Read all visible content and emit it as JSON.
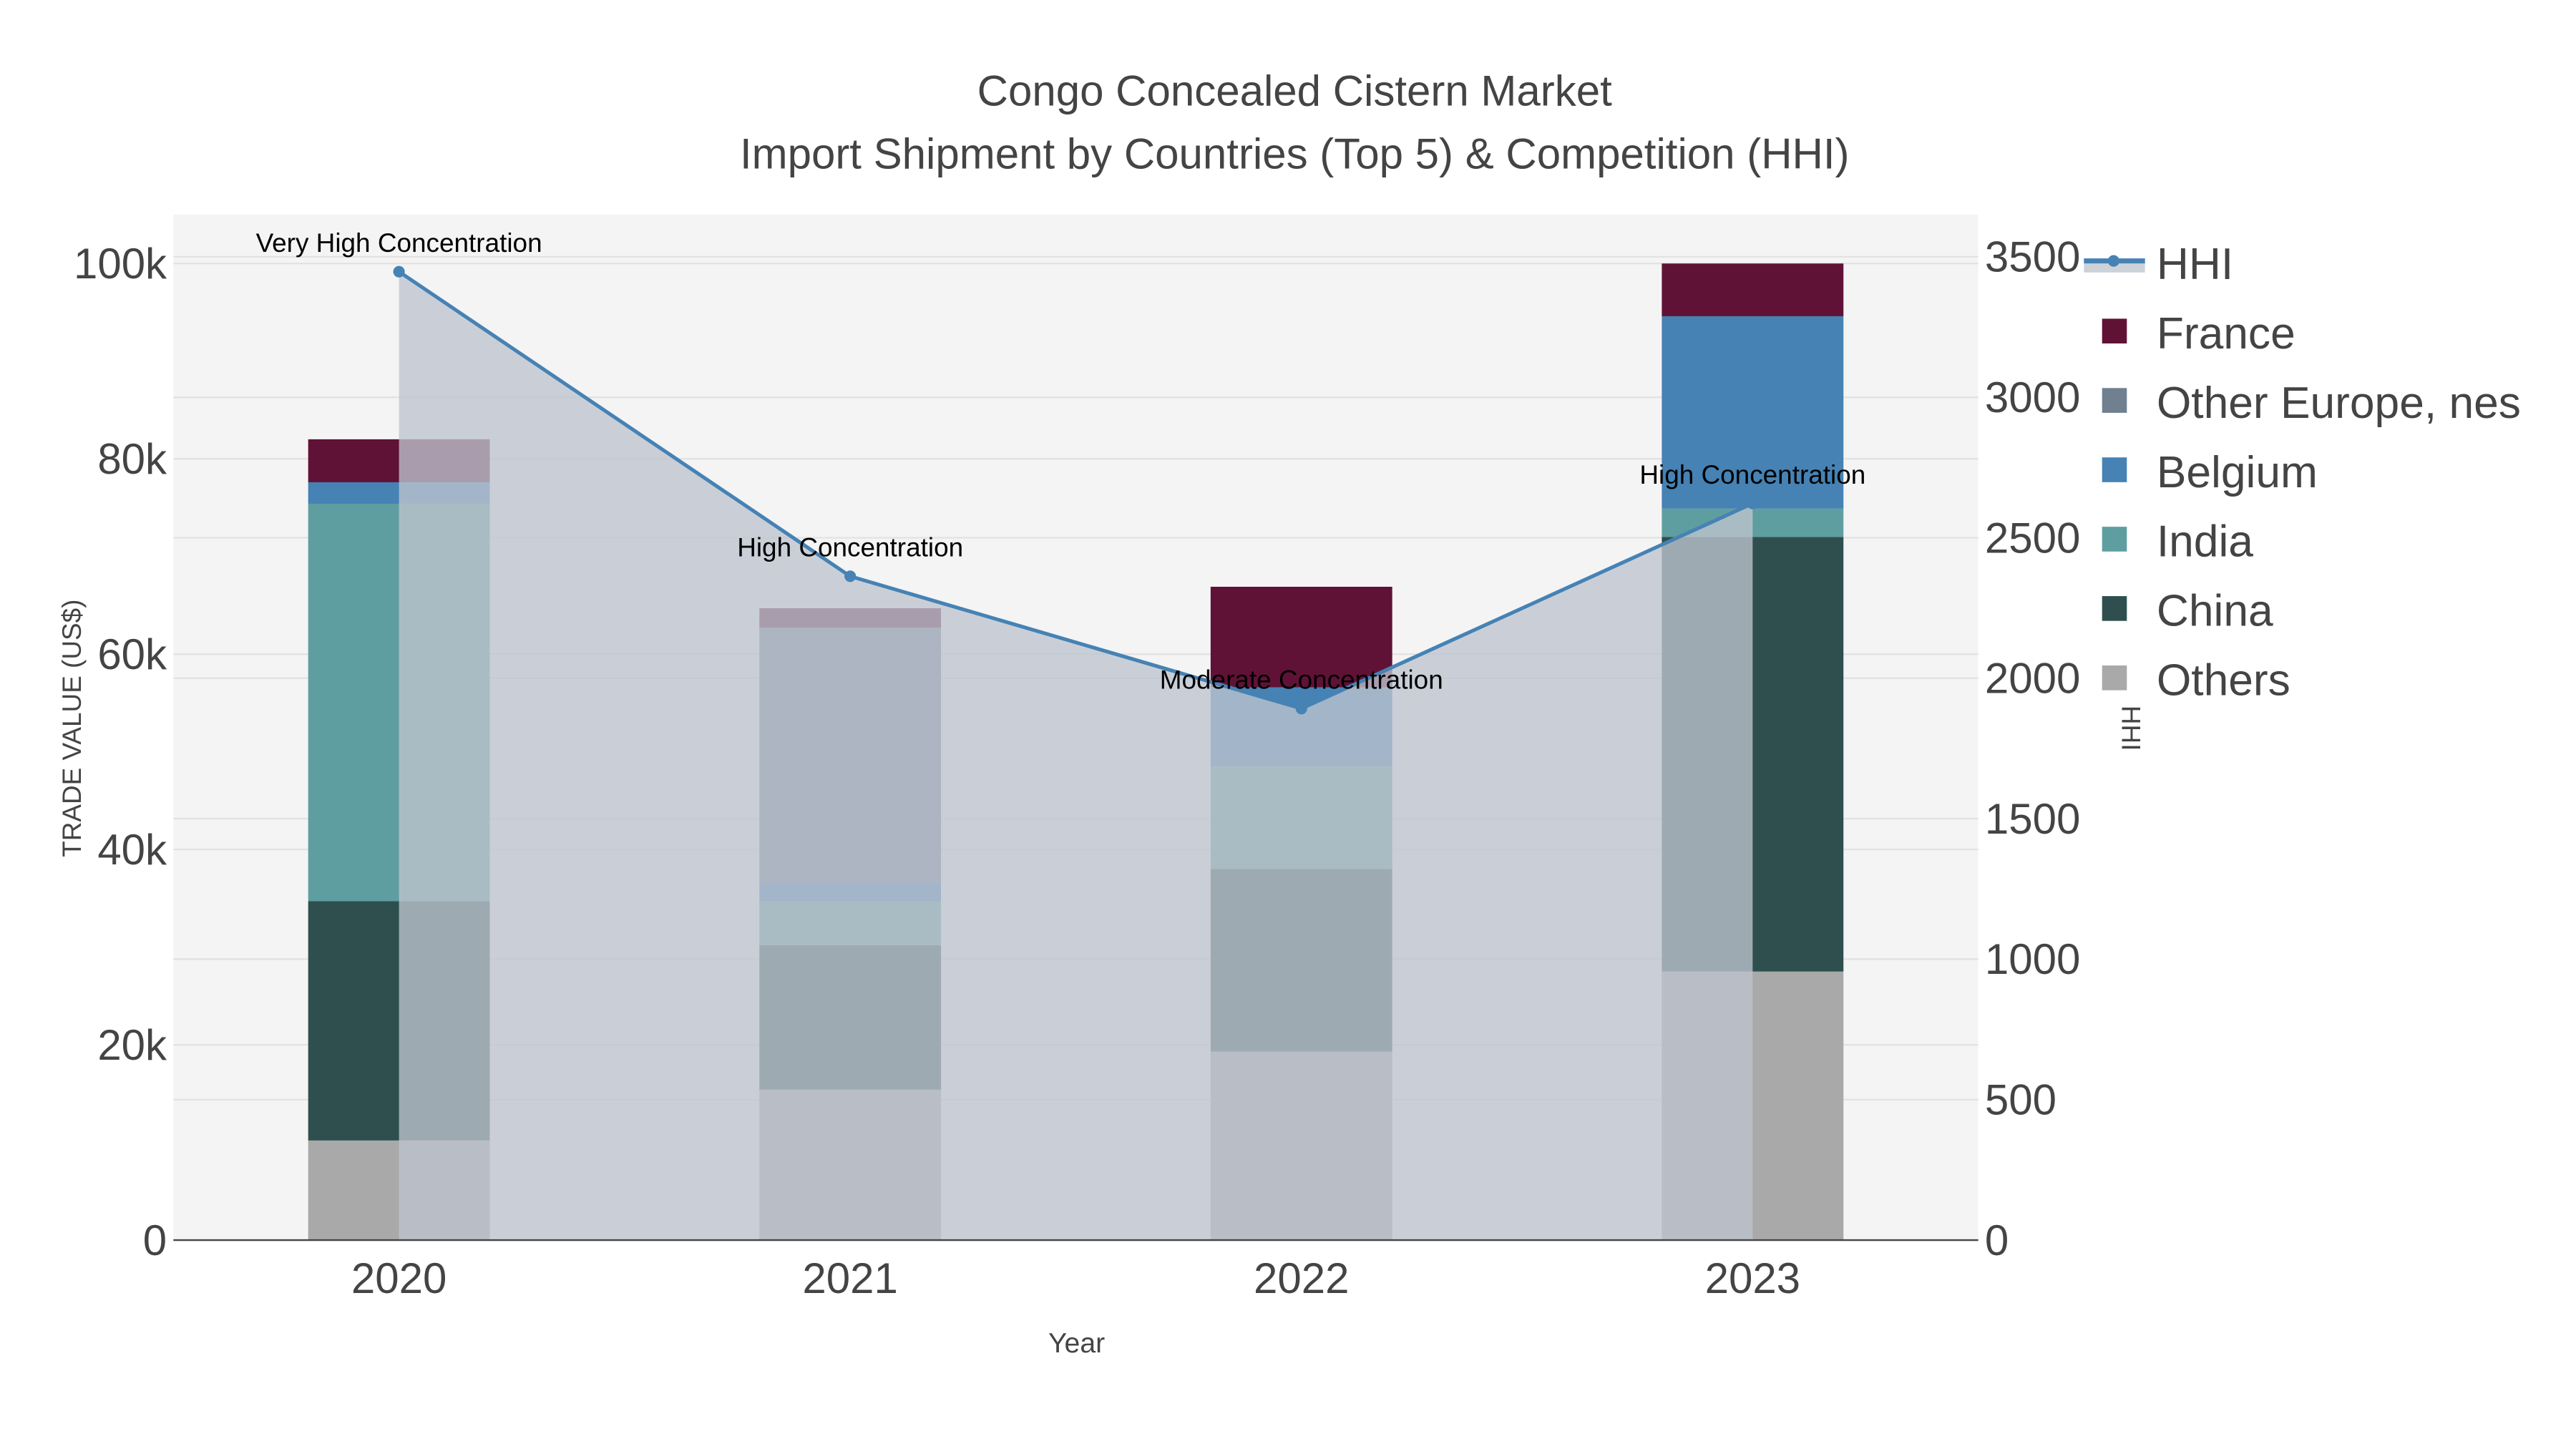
{
  "chart_data": {
    "type": "bar",
    "title": "Congo Concealed Cistern Market",
    "subtitle": "Import Shipment by Countries (Top 5) & Competition (HHI)",
    "xlabel": "Year",
    "ylabel": "TRADE VALUE (US$)",
    "y2label": "HHI",
    "categories": [
      "2020",
      "2021",
      "2022",
      "2023"
    ],
    "ylim": [
      0,
      105000
    ],
    "y2lim": [
      0,
      3650
    ],
    "yticks": [
      0,
      20000,
      40000,
      60000,
      80000,
      100000
    ],
    "ytick_labels": [
      "0",
      "20k",
      "40k",
      "60k",
      "80k",
      "100k"
    ],
    "y2ticks": [
      0,
      500,
      1000,
      1500,
      2000,
      2500,
      3000,
      3500
    ],
    "y2tick_labels": [
      "0",
      "500",
      "1000",
      "1500",
      "2000",
      "2500",
      "3000",
      "3500"
    ],
    "grid": true,
    "legend_position": "right",
    "series": [
      {
        "name": "Others",
        "color": "#a9a9a9",
        "values": [
          10200,
          15400,
          19300,
          27500
        ]
      },
      {
        "name": "China",
        "color": "#2f4f4f",
        "values": [
          24500,
          14800,
          18700,
          44500
        ]
      },
      {
        "name": "India",
        "color": "#5f9ea0",
        "values": [
          40700,
          4500,
          10500,
          2900
        ]
      },
      {
        "name": "Belgium",
        "color": "#4682b4",
        "values": [
          2200,
          1900,
          8100,
          19700
        ]
      },
      {
        "name": "Other Europe, nes",
        "color": "#708090",
        "values": [
          0,
          26100,
          0,
          0
        ]
      },
      {
        "name": "France",
        "color": "#601236",
        "values": [
          4400,
          2000,
          10300,
          5400
        ]
      }
    ],
    "hhi": {
      "name": "HHI",
      "color": "#4682b4",
      "values": [
        3447,
        2363,
        1892,
        2622
      ],
      "annotations": [
        "Very High Concentration",
        "High Concentration",
        "Moderate Concentration",
        "High Concentration"
      ]
    },
    "legend_order": [
      "HHI",
      "France",
      "Other Europe, nes",
      "Belgium",
      "India",
      "China",
      "Others"
    ]
  }
}
